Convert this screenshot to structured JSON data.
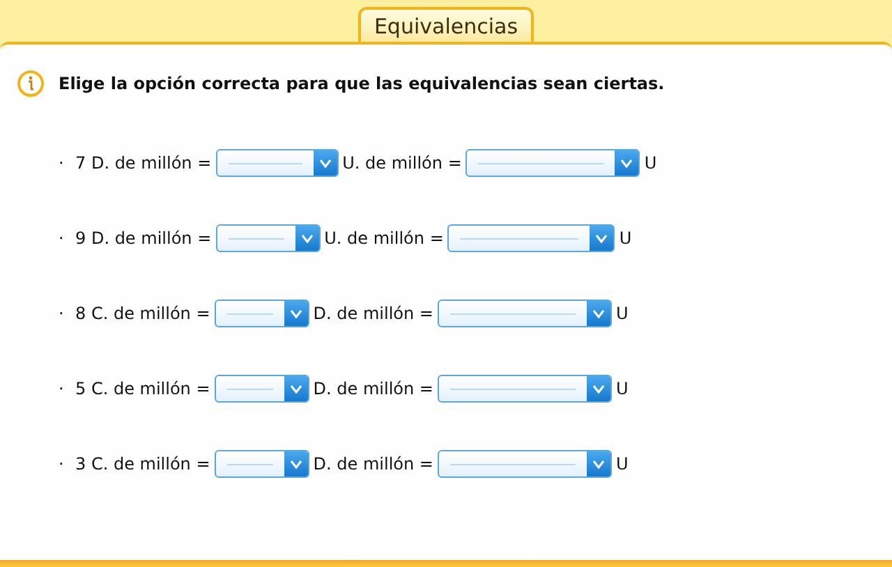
{
  "tab": {
    "label": "Equivalencias"
  },
  "instruction": "Elige la opción correcta para que las equivalencias sean ciertas.",
  "rows": [
    {
      "bullet": "·",
      "lead": "7 D. de millón =",
      "middle": "U. de millón =",
      "end": "U"
    },
    {
      "bullet": "·",
      "lead": "9 D. de millón =",
      "middle": "U. de millón =",
      "end": "U"
    },
    {
      "bullet": "·",
      "lead": "8 C. de millón =",
      "middle": "D. de millón =",
      "end": "U"
    },
    {
      "bullet": "·",
      "lead": "5 C. de millón =",
      "middle": "D. de millón =",
      "end": "U"
    },
    {
      "bullet": "·",
      "lead": "3 C. de millón =",
      "middle": "D. de millón =",
      "end": "U"
    }
  ]
}
